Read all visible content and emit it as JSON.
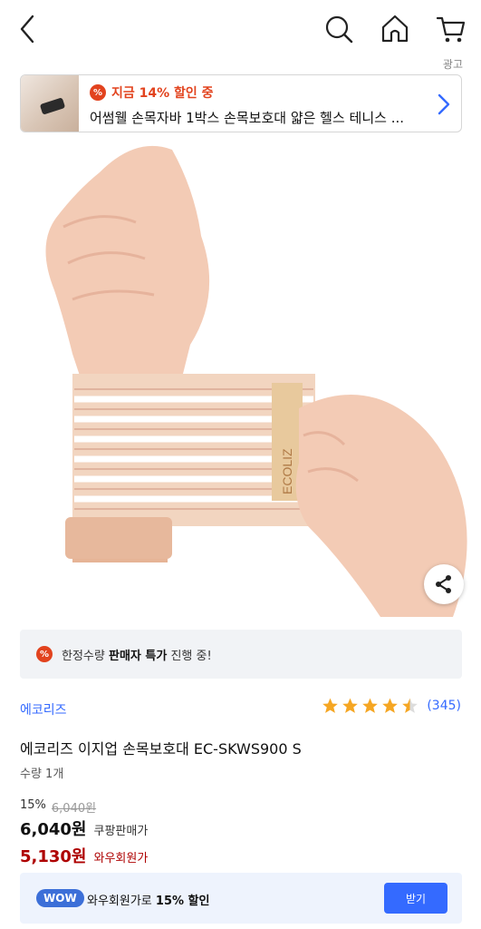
{
  "header": {
    "back_icon": "chevron-left-icon",
    "search_icon": "search-icon",
    "home_icon": "home-icon",
    "cart_icon": "cart-icon",
    "ad_label": "광고"
  },
  "ad_banner": {
    "discount_badge": "%",
    "discount_text": "지금 14% 할인 중",
    "title": "어썸웰 손목자바 1박스 손목보호대 얇은 헬스 테니스 ...",
    "chevron_icon": "chevron-right-icon"
  },
  "product_image": {
    "brand_on_strap": "ECOLIZ"
  },
  "promo": {
    "badge": "%",
    "text_prefix": "한정수량 ",
    "text_bold": "판매자 특가",
    "text_suffix": " 진행 중!"
  },
  "product": {
    "brand": "에코리즈",
    "rating": 4.5,
    "review_count": "(345)",
    "name": "에코리즈 이지업 손목보호대 EC-SKWS900 S",
    "quantity": "수량 1개"
  },
  "price": {
    "discount_rate": "15%",
    "original": "6,040원",
    "coupang_price": "6,040원",
    "coupang_label": "쿠팡판매가",
    "wow_price": "5,130원",
    "wow_label": "와우회원가"
  },
  "wow_bar": {
    "badge": "WOW",
    "text_prefix": "와우회원가로 ",
    "text_bold": "15% 할인",
    "button": "받기"
  },
  "colors": {
    "accent_blue": "#346aff",
    "discount_red": "#e2431e",
    "wow_red": "#ae0000",
    "star": "#f5a623"
  }
}
